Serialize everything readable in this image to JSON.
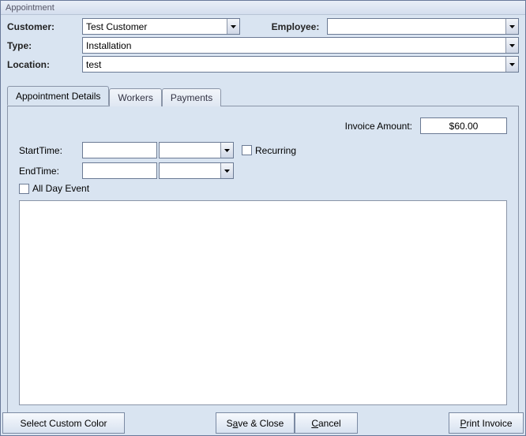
{
  "window": {
    "title": "Appointment"
  },
  "header": {
    "customer_label": "Customer:",
    "customer_value": "Test Customer",
    "employee_label": "Employee:",
    "employee_value": "",
    "type_label": "Type:",
    "type_value": "Installation",
    "location_label": "Location:",
    "location_value": "test"
  },
  "tabs": {
    "details": "Appointment Details",
    "workers": "Workers",
    "payments": "Payments"
  },
  "panel": {
    "invoice_label": "Invoice Amount:",
    "invoice_value": "$60.00",
    "starttime_label": "StartTime:",
    "starttime_date": "",
    "starttime_time": "",
    "recurring_label": "Recurring",
    "endtime_label": "EndTime:",
    "endtime_date": "",
    "endtime_time": "",
    "allday_label": "All Day Event",
    "notes": ""
  },
  "buttons": {
    "select_color": "Select Custom Color",
    "save_close_pre": "S",
    "save_close_u": "a",
    "save_close_post": "ve & Close",
    "cancel_u": "C",
    "cancel_post": "ancel",
    "print_u": "P",
    "print_post": "rint Invoice"
  }
}
